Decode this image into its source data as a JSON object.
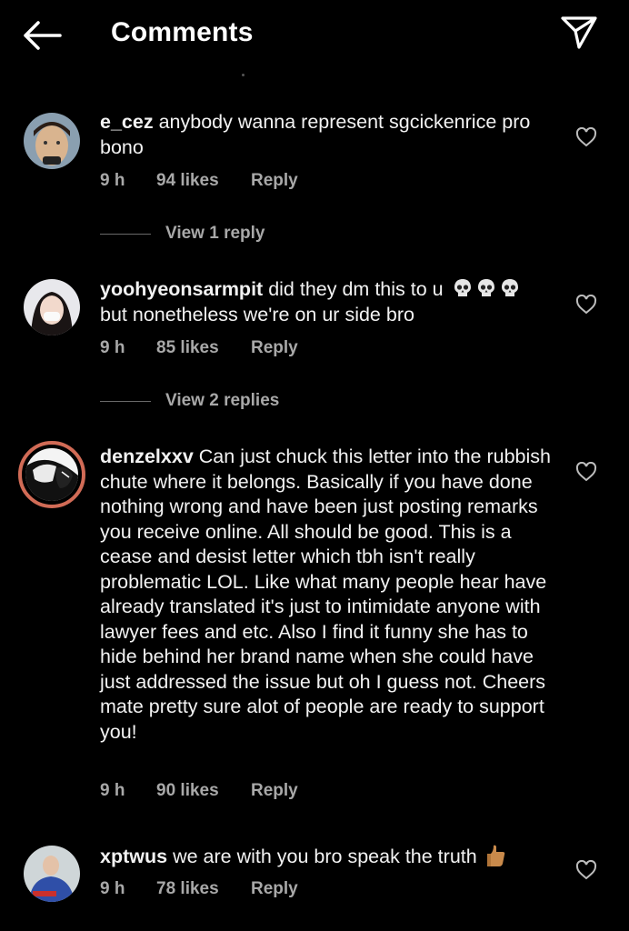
{
  "header": {
    "title": "Comments",
    "back_icon": "arrow-left-icon",
    "send_icon": "paper-plane-icon"
  },
  "comments": [
    {
      "username": "e_cez",
      "text": "anybody wanna represent sgcickenrice pro bono",
      "time": "9 h",
      "likes": "94 likes",
      "reply": "Reply",
      "view_replies": "View 1 reply"
    },
    {
      "username": "yoohyeonsarmpit",
      "text_before_emoji": "did they dm this to u",
      "emoji": "skull-emoji x3",
      "text_after_emoji": "but nonetheless we're on ur side bro",
      "time": "9 h",
      "likes": "85 likes",
      "reply": "Reply",
      "view_replies": "View 2 replies"
    },
    {
      "username": "denzelxxv",
      "text": "Can just chuck this letter into the rubbish chute where it belongs. Basically if you have done nothing wrong and have been just posting remarks you receive online. All should be good. This is a cease and desist letter which tbh isn't really problematic LOL. Like what many people hear have already translated it's just to intimidate anyone with lawyer fees and etc. Also I find it funny she has to hide behind her brand name when she could have just addressed the issue but oh I guess not. Cheers mate pretty sure alot of people are ready to support you!",
      "time": "9 h",
      "likes": "90 likes",
      "reply": "Reply"
    },
    {
      "username": "xptwus",
      "text": "we are with you bro speak the truth",
      "emoji": "thumbs-up-emoji",
      "time": "9 h",
      "likes": "78 likes",
      "reply": "Reply"
    }
  ],
  "colors": {
    "background": "#000000",
    "text": "#f2f2f2",
    "meta": "#a8a8a8",
    "story_ring": "#d16b56"
  }
}
